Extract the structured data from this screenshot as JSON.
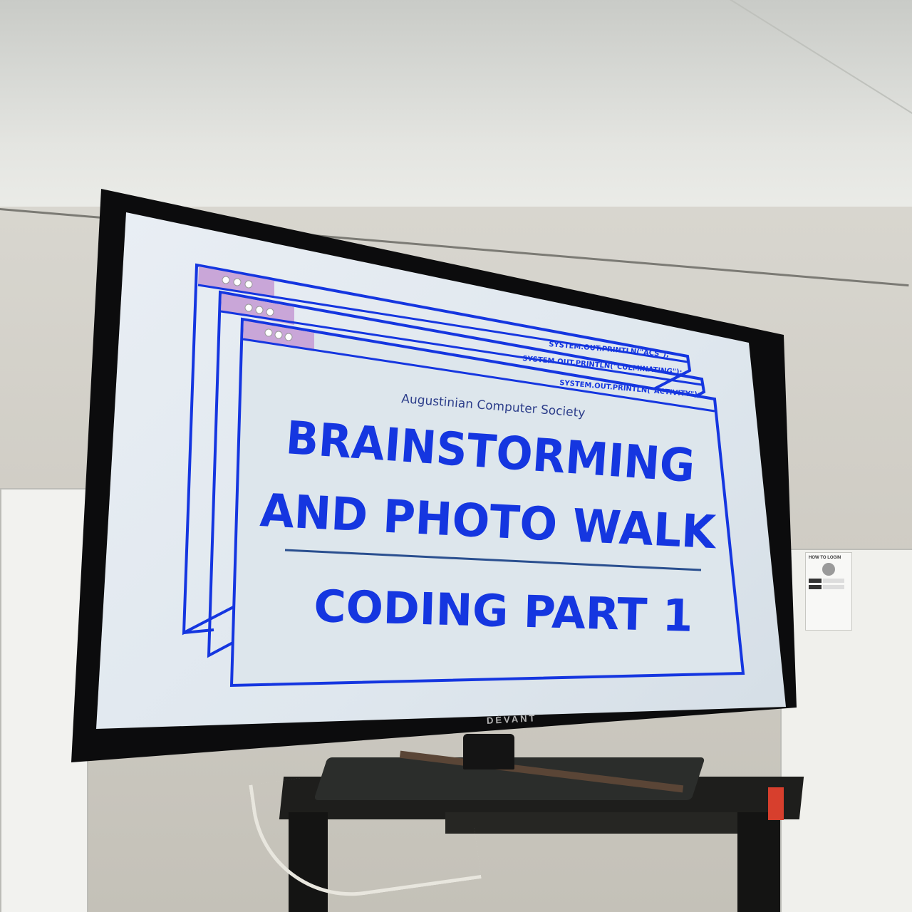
{
  "slide": {
    "code_lines": [
      "SYSTEM.OUT.PRINTLN(\"ACS\");",
      "SYSTEM.OUT.PRINTLN(\"CULMINATING\");",
      "SYSTEM.OUT.PRINTLN(\"ACTIVITY\");"
    ],
    "organization": "Augustinian Computer Society",
    "title_line1": "BRAINSTORMING",
    "title_line2": "AND PHOTO WALK",
    "subtitle": "CODING PART 1",
    "accent_color": "#1536e0",
    "titlebar_color": "#c9a6d8"
  },
  "tv": {
    "brand": "DÉVANT"
  },
  "wall_sign": {
    "title": "HOW TO LOGIN"
  }
}
